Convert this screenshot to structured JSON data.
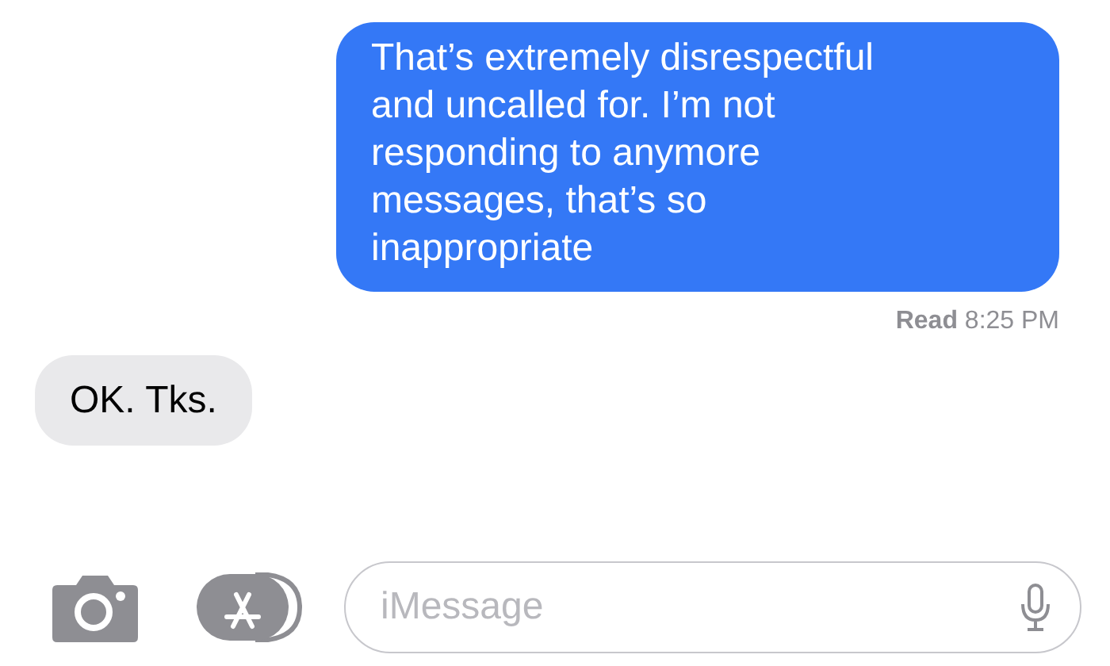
{
  "messages": [
    {
      "kind": "sent",
      "text": "That’s extremely disrespectful\nand uncalled for. I’m not\nresponding to anymore\nmessages, that’s so\ninappropriate"
    },
    {
      "kind": "receipt",
      "text": "**Read** 8:25 PM"
    },
    {
      "kind": "received",
      "text": "OK. Tks."
    }
  ],
  "composer": {
    "placeholder": "iMessage"
  }
}
